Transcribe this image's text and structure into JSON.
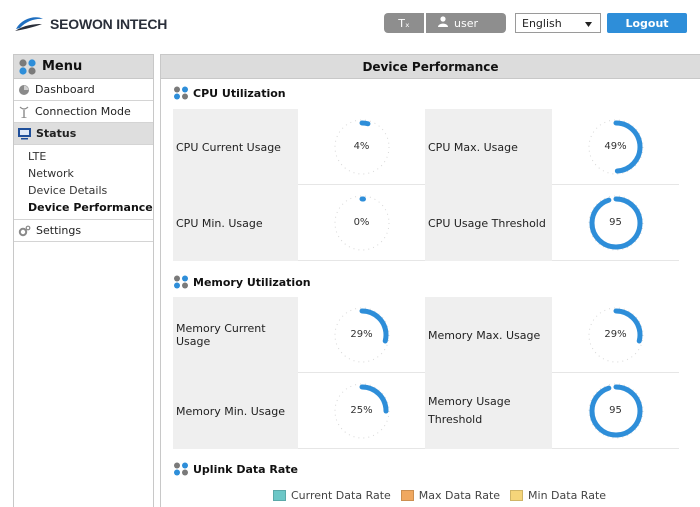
{
  "header": {
    "logo_text": "SEOWON INTECH",
    "clear_format_label": "Tₓ",
    "user_label": "user",
    "language_selected": "English",
    "logout_label": "Logout"
  },
  "sidebar": {
    "menu_title": "Menu",
    "items": [
      {
        "label": "Dashboard",
        "icon": "dashboard-icon"
      },
      {
        "label": "Connection Mode",
        "icon": "antenna-icon"
      },
      {
        "label": "Status",
        "icon": "monitor-icon"
      },
      {
        "label": "Settings",
        "icon": "gear-icon"
      }
    ],
    "status_subitems": [
      "LTE",
      "Network",
      "Device Details",
      "Device Performance"
    ]
  },
  "main": {
    "title": "Device Performance",
    "cpu": {
      "section_title": "CPU Utilization",
      "current_label": "CPU Current Usage",
      "current_value": "4%",
      "current_pct": 4,
      "max_label": "CPU Max. Usage",
      "max_value": "49%",
      "max_pct": 49,
      "min_label": "CPU Min. Usage",
      "min_value": "0%",
      "min_pct": 0,
      "threshold_label": "CPU Usage Threshold",
      "threshold_value": "95",
      "threshold_pct": 95
    },
    "memory": {
      "section_title": "Memory Utilization",
      "current_label": "Memory Current Usage",
      "current_value": "29%",
      "current_pct": 29,
      "max_label": "Memory Max. Usage",
      "max_value": "29%",
      "max_pct": 29,
      "min_label": "Memory Min. Usage",
      "min_value": "25%",
      "min_pct": 25,
      "threshold_label": "Memory Usage Threshold",
      "threshold_value": "95",
      "threshold_pct": 95
    },
    "uplink": {
      "section_title": "Uplink Data Rate",
      "legend": [
        {
          "label": "Current Data Rate",
          "color": "#6cc7c7"
        },
        {
          "label": "Max Data Rate",
          "color": "#f0a860"
        },
        {
          "label": "Min Data Rate",
          "color": "#f5d57a"
        }
      ]
    }
  },
  "colors": {
    "accent": "#2e8ed9",
    "gauge_arc": "#2e8ed9"
  }
}
